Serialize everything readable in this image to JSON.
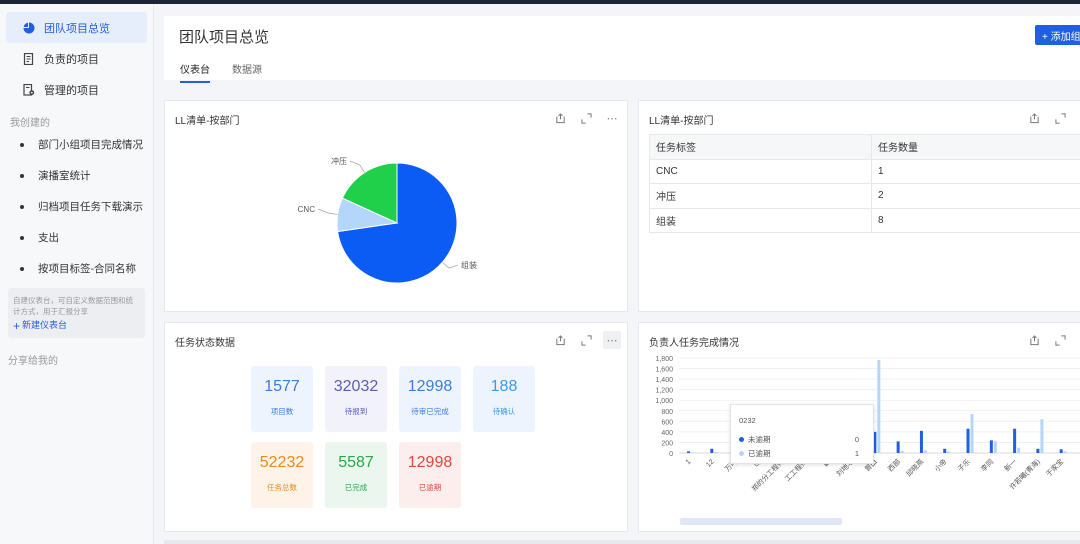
{
  "sidebar": {
    "items": [
      {
        "label": "团队项目总览",
        "icon": "pie-chart-icon",
        "active": true
      },
      {
        "label": "负责的项目",
        "icon": "document-list-icon",
        "active": false
      },
      {
        "label": "管理的项目",
        "icon": "document-gear-icon",
        "active": false
      }
    ],
    "created_label": "我创建的",
    "dashboards": [
      "部门小组项目完成情况",
      "演播室统计",
      "归档项目任务下载演示",
      "支出",
      "按项目标签-合同名称"
    ],
    "info_text": "自建仪表台，可自定义数据范围和统计方式，用于汇报分享",
    "new_dashboard": "新建仪表台",
    "shared_label": "分享给我的"
  },
  "header": {
    "title": "团队项目总览",
    "tabs": [
      "仪表台",
      "数据源"
    ],
    "add_button": "+ 添加组件"
  },
  "colors": {
    "primary": "#1f5fe0",
    "pie_blue": "#0b5cf5",
    "pie_light": "#b5d6fb",
    "pie_green": "#20cf4a"
  },
  "cards": {
    "pie": {
      "title": "LL清单-按部门"
    },
    "table": {
      "title": "LL清单-按部门",
      "headers": [
        "任务标签",
        "任务数量"
      ],
      "rows": [
        [
          "CNC",
          "1"
        ],
        [
          "冲压",
          "2"
        ],
        [
          "组装",
          "8"
        ]
      ]
    },
    "status": {
      "title": "任务状态数据",
      "tiles": [
        {
          "value": "1577",
          "label": "项目数",
          "color": "#3a7de0",
          "bg": "#eef4fd"
        },
        {
          "value": "32032",
          "label": "待报到",
          "color": "#5a5db8",
          "bg": "#f2f2fa"
        },
        {
          "value": "12998",
          "label": "待审已完成",
          "color": "#3a7de0",
          "bg": "#eef4fd"
        },
        {
          "value": "188",
          "label": "待确认",
          "color": "#3a9ae6",
          "bg": "#eef4fd"
        },
        {
          "value": "52232",
          "label": "任务总数",
          "color": "#f0891e",
          "bg": "#fdf3e8"
        },
        {
          "value": "5587",
          "label": "已完成",
          "color": "#27a84a",
          "bg": "#ebf7ee"
        },
        {
          "value": "12998",
          "label": "已逾期",
          "color": "#e0473c",
          "bg": "#fdeeee"
        }
      ]
    },
    "bars": {
      "title": "负责人任务完成情况"
    }
  },
  "tooltip": {
    "title": "0232",
    "rows": [
      {
        "name": "未逾期",
        "value": "0",
        "color": "#1f5fe0"
      },
      {
        "name": "已逾期",
        "value": "1",
        "color": "#b5d6fb"
      }
    ]
  },
  "chart_data": [
    {
      "type": "pie",
      "title": "LL清单-按部门",
      "categories": [
        "组装",
        "CNC",
        "冲压"
      ],
      "values": [
        8,
        1,
        2
      ]
    },
    {
      "type": "bar",
      "title": "负责人任务完成情况",
      "ylim": [
        0,
        1800
      ],
      "yticks": [
        0,
        200,
        400,
        600,
        800,
        1000,
        1200,
        1400,
        1600,
        1800
      ],
      "ytick_labels": [
        "0",
        "200",
        "400",
        "600",
        "800",
        "1,000",
        "1,200",
        "1,400",
        "1,600",
        "1,800"
      ],
      "categories": [
        "1",
        "12",
        "万叶",
        "巴",
        "郑的分工程师",
        "工工程师",
        "霸",
        "刘地华",
        "曾田",
        "西部",
        "邱晓燕",
        "小帝",
        "子乐",
        "李同",
        "新一",
        "许若曦(青海)",
        "于家宝"
      ],
      "series": [
        {
          "name": "未逾期",
          "values": [
            30,
            80,
            580,
            60,
            40,
            40,
            50,
            280,
            400,
            220,
            420,
            80,
            460,
            240,
            460,
            80,
            70
          ]
        },
        {
          "name": "已逾期",
          "values": [
            10,
            20,
            30,
            20,
            10,
            10,
            10,
            40,
            1760,
            40,
            50,
            30,
            740,
            220,
            100,
            640,
            30
          ]
        }
      ]
    }
  ]
}
